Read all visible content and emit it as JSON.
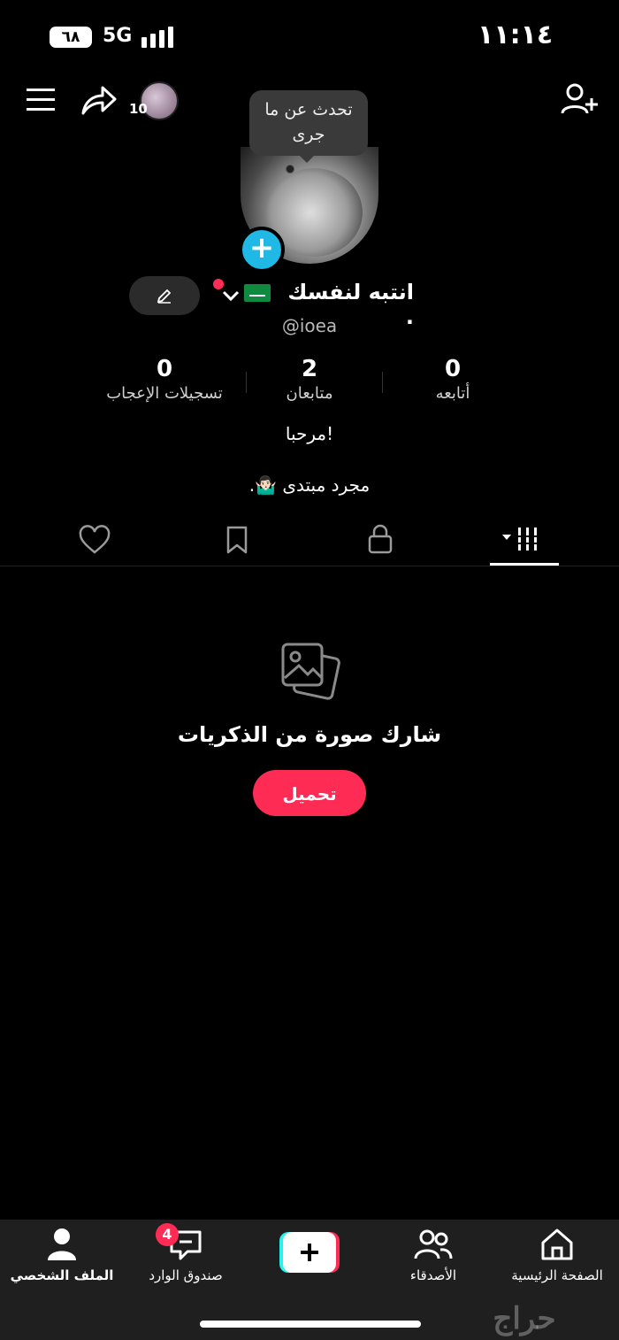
{
  "status_bar": {
    "time": "١١:١٤",
    "network": "5G",
    "battery": "٦٨"
  },
  "header": {
    "story_badge_count": "10"
  },
  "profile": {
    "tooltip": "تحدث عن ما جرى",
    "display_name": "انتبه لنفسك .",
    "username": "@ioea",
    "stats": [
      {
        "value": "0",
        "label": "أتابعه"
      },
      {
        "value": "2",
        "label": "متابعان"
      },
      {
        "value": "0",
        "label": "تسجيلات الإعجاب"
      }
    ],
    "bio_line1": "مرحبا!",
    "bio_line2": "مجرد مبتدى 🤷🏻‍♂️."
  },
  "tabs": [
    "videos-grid",
    "private-lock",
    "saved-bookmark",
    "liked-heart"
  ],
  "empty_state": {
    "message": "شارك صورة من الذكريات",
    "button": "تحميل"
  },
  "bottom_nav": {
    "home": "الصفحة الرئيسية",
    "friends": "الأصدقاء",
    "inbox": "صندوق الوارد",
    "inbox_badge": "4",
    "profile": "الملف الشخصي"
  },
  "colors": {
    "accent": "#fe2c55",
    "plus_blue": "#20b9e6",
    "flag_green": "#0f8a3e"
  }
}
